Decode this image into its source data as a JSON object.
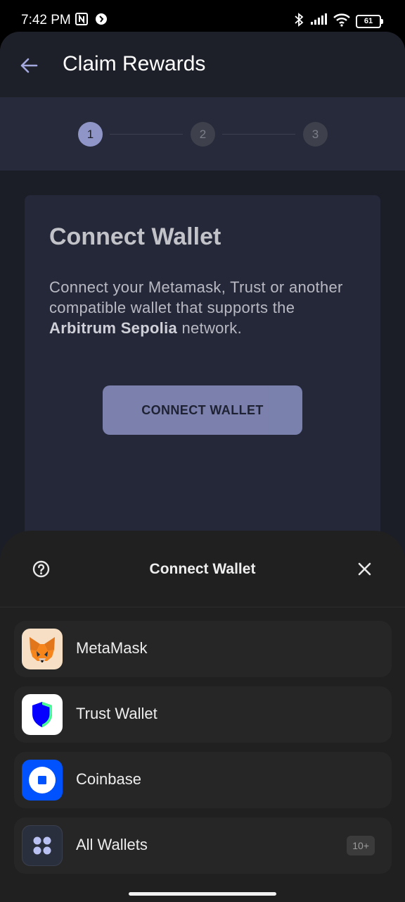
{
  "status_bar": {
    "time": "7:42 PM",
    "battery": "61",
    "icons": [
      "nfc-icon",
      "app-notification-icon",
      "bluetooth-icon",
      "signal-icon",
      "wifi-icon",
      "battery-icon"
    ]
  },
  "app_bar": {
    "back_icon": "arrow-left-icon",
    "title": "Claim Rewards"
  },
  "stepper": {
    "steps": [
      {
        "label": "1",
        "state": "active"
      },
      {
        "label": "2",
        "state": "inactive"
      },
      {
        "label": "3",
        "state": "inactive"
      }
    ]
  },
  "card": {
    "title": "Connect Wallet",
    "description_prefix": "Connect your Metamask, Trust or another compatible wallet that supports the ",
    "network_name": "Arbitrum Sepolia",
    "description_suffix": " network.",
    "button_label": "CONNECT WALLET"
  },
  "wallet_sheet": {
    "title": "Connect Wallet",
    "help_icon": "help-circle-icon",
    "close_icon": "close-icon",
    "wallets": [
      {
        "name": "MetaMask",
        "icon": "metamask-fox-icon"
      },
      {
        "name": "Trust Wallet",
        "icon": "trust-wallet-shield-icon"
      },
      {
        "name": "Coinbase",
        "icon": "coinbase-icon"
      },
      {
        "name": "All Wallets",
        "icon": "grid-dots-icon",
        "badge": "10+"
      }
    ]
  },
  "colors": {
    "accent": "#8f96c7",
    "background": "#1c1e27",
    "card": "#252839",
    "sheet": "#202020",
    "coinbase_blue": "#0052ff"
  }
}
